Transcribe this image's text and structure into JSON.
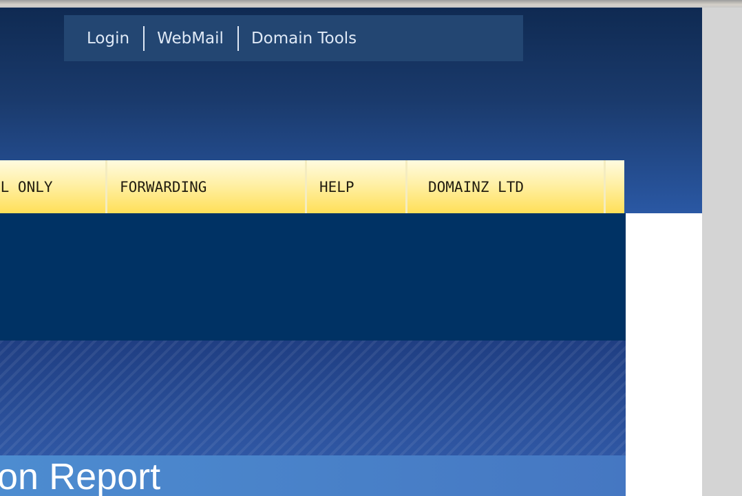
{
  "top_links": [
    "Login",
    "WebMail",
    "Domain Tools"
  ],
  "nav": [
    "IL ONLY",
    "FORWARDING",
    "HELP",
    "DOMAINZ LTD"
  ],
  "banner": {
    "title": "on Report"
  }
}
